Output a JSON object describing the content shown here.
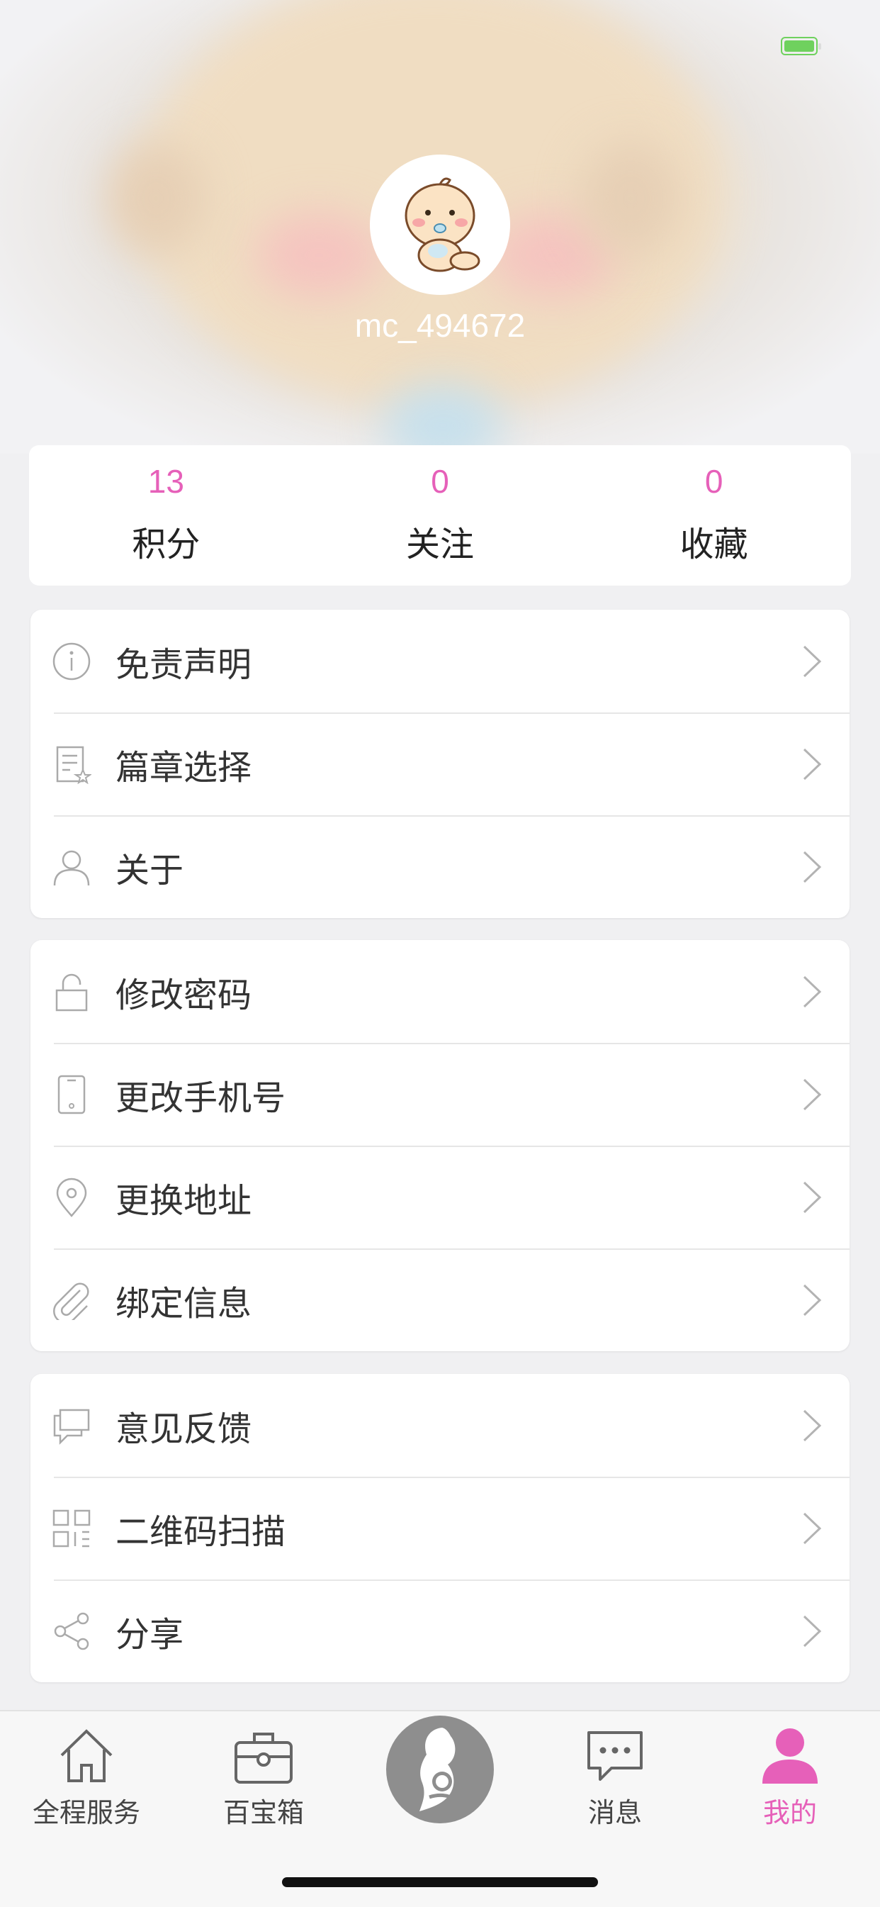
{
  "profile": {
    "username": "mc_494672"
  },
  "stats": [
    {
      "value": "13",
      "label": "积分"
    },
    {
      "value": "0",
      "label": "关注"
    },
    {
      "value": "0",
      "label": "收藏"
    }
  ],
  "menu_group_1": [
    {
      "label": "免责声明",
      "icon": "info-icon"
    },
    {
      "label": "篇章选择",
      "icon": "document-star-icon"
    },
    {
      "label": "关于",
      "icon": "person-icon"
    }
  ],
  "menu_group_2": [
    {
      "label": "修改密码",
      "icon": "lock-icon"
    },
    {
      "label": "更改手机号",
      "icon": "phone-icon"
    },
    {
      "label": "更换地址",
      "icon": "location-pin-icon"
    },
    {
      "label": "绑定信息",
      "icon": "paperclip-icon"
    }
  ],
  "menu_group_3": [
    {
      "label": "意见反馈",
      "icon": "chat-bubble-icon"
    },
    {
      "label": "二维码扫描",
      "icon": "qr-code-icon"
    },
    {
      "label": "分享",
      "icon": "share-icon"
    }
  ],
  "tabbar": [
    {
      "label": "全程服务",
      "icon": "home-icon"
    },
    {
      "label": "百宝箱",
      "icon": "briefcase-icon"
    },
    {
      "label": "",
      "icon": "mother-baby-icon"
    },
    {
      "label": "消息",
      "icon": "message-icon"
    },
    {
      "label": "我的",
      "icon": "user-icon"
    }
  ],
  "colors": {
    "accent": "#e660b9",
    "battery": "#6fd15e"
  }
}
